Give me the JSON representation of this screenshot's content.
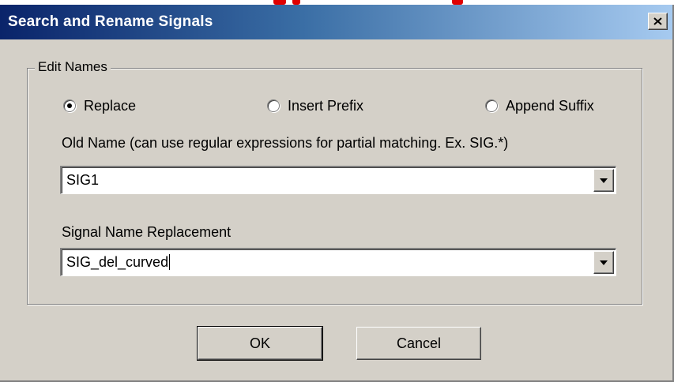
{
  "window": {
    "title": "Search and Rename Signals",
    "close_symbol": "✕"
  },
  "group": {
    "legend": "Edit Names"
  },
  "mode": {
    "options": [
      {
        "label": "Replace",
        "selected": true
      },
      {
        "label": "Insert Prefix",
        "selected": false
      },
      {
        "label": "Append Suffix",
        "selected": false
      }
    ]
  },
  "old_name": {
    "label": "Old Name (can use regular expressions for partial matching. Ex. SIG.*)",
    "value": "SIG1"
  },
  "replacement": {
    "label": "Signal Name Replacement",
    "value": "SIG_del_curved"
  },
  "buttons": {
    "ok": "OK",
    "cancel": "Cancel"
  },
  "icons": {
    "close": "close-icon",
    "dropdown": "chevron-down-icon"
  },
  "colors": {
    "titlebar_start": "#0a246a",
    "titlebar_end": "#a6caf0",
    "face": "#d4d0c8"
  }
}
